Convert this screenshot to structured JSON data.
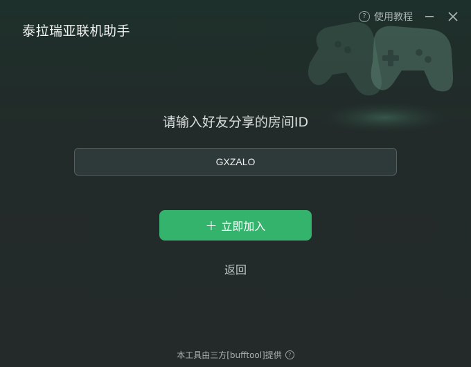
{
  "app": {
    "title": "泰拉瑞亚联机助手"
  },
  "header": {
    "help_label": "使用教程",
    "help_icon": "question-circle-icon",
    "minimize_icon": "minimize-icon",
    "close_icon": "close-icon"
  },
  "main": {
    "heading": "请输入好友分享的房间ID",
    "room_input_value": "GXZALO",
    "join_button_label": "立即加入",
    "join_icon": "plus-icon",
    "back_label": "返回"
  },
  "footer": {
    "text": "本工具由三方[bufftool]提供",
    "info_icon": "question-circle-icon"
  },
  "colors": {
    "accent": "#33b36c",
    "background": "#222b29"
  }
}
